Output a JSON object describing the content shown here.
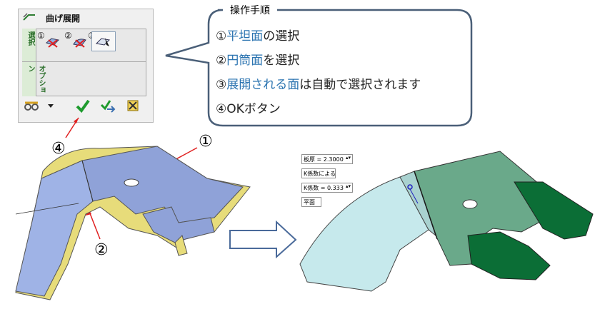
{
  "dialog": {
    "title": "曲げ展開",
    "tabs": {
      "select": "選択",
      "option": "オプション"
    },
    "tool_numbers": [
      "①",
      "②",
      "③"
    ]
  },
  "callout": {
    "title": "操作手順",
    "steps": [
      {
        "num": "①",
        "highlight": "平坦面",
        "rest": "の選択"
      },
      {
        "num": "②",
        "highlight": "円筒面",
        "rest": "を選択"
      },
      {
        "num": "③",
        "highlight": "展開される面",
        "rest": "は自動で選択されます"
      },
      {
        "num": "④",
        "highlight": "",
        "rest": "OKボタン"
      }
    ]
  },
  "annotations": {
    "a1": "①",
    "a2": "②",
    "a4": "④"
  },
  "right_panel": {
    "thickness": "板厚 =  2.3000",
    "kfactor_button": "K係数による",
    "kfactor": "K係数 = 0.333",
    "plane_button": "平面"
  },
  "colors": {
    "accent": "#2a73b0",
    "callout_border": "#4a5f78",
    "red": "#e02020",
    "green_dark": "#0b6e36",
    "green_mid": "#6aa98a",
    "cyan": "#bfe6ea",
    "yellow": "#e7dc7a",
    "blue_part": "#8fa2d8"
  }
}
